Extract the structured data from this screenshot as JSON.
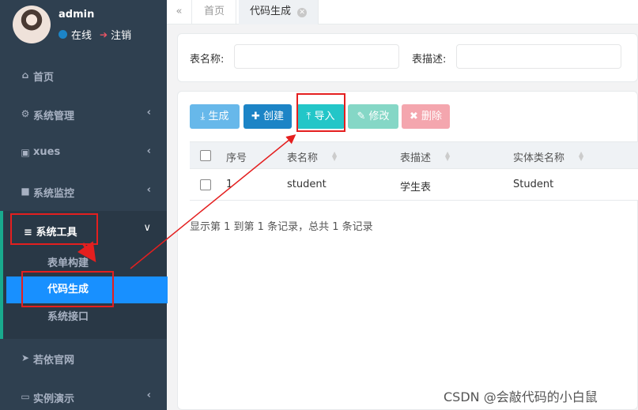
{
  "sidebar": {
    "user": {
      "name": "admin",
      "status": "在线",
      "logout": "注销"
    },
    "menu": [
      {
        "icon": "home-icon",
        "label": "首页",
        "has_arrow": false
      },
      {
        "icon": "gear-icon",
        "label": "系统管理",
        "has_arrow": true
      },
      {
        "icon": "id-card-icon",
        "label": "xues",
        "has_arrow": true
      },
      {
        "icon": "video-camera-icon",
        "label": "系统监控",
        "has_arrow": true
      }
    ],
    "tools": {
      "label": "系统工具",
      "items": [
        "表单构建",
        "代码生成",
        "系统接口"
      ],
      "active_index": 1
    },
    "menu_bottom": [
      {
        "icon": "paper-plane-icon",
        "label": "若依官网",
        "has_arrow": false
      },
      {
        "icon": "desktop-icon",
        "label": "实例演示",
        "has_arrow": true
      }
    ]
  },
  "tabs": [
    {
      "label": "首页",
      "active": false
    },
    {
      "label": "代码生成",
      "active": true
    }
  ],
  "search": {
    "table_name_label": "表名称:",
    "table_name_value": "",
    "table_desc_label": "表描述:",
    "table_desc_value": ""
  },
  "toolbar": {
    "generate": "生成",
    "create": "创建",
    "import": "导入",
    "edit": "修改",
    "delete": "删除"
  },
  "table": {
    "columns": [
      "序号",
      "表名称",
      "表描述",
      "实体类名称"
    ],
    "rows": [
      {
        "index": "1",
        "table_name": "student",
        "table_desc": "学生表",
        "class_name": "Student"
      }
    ],
    "summary": "显示第 1 到第 1 条记录，总共 1 条记录"
  },
  "colors": {
    "sidebar_bg": "#2f4050",
    "active_menu": "#1890ff",
    "annotation": "#e41f1f"
  },
  "watermark": "CSDN @会敲代码的小白鼠"
}
